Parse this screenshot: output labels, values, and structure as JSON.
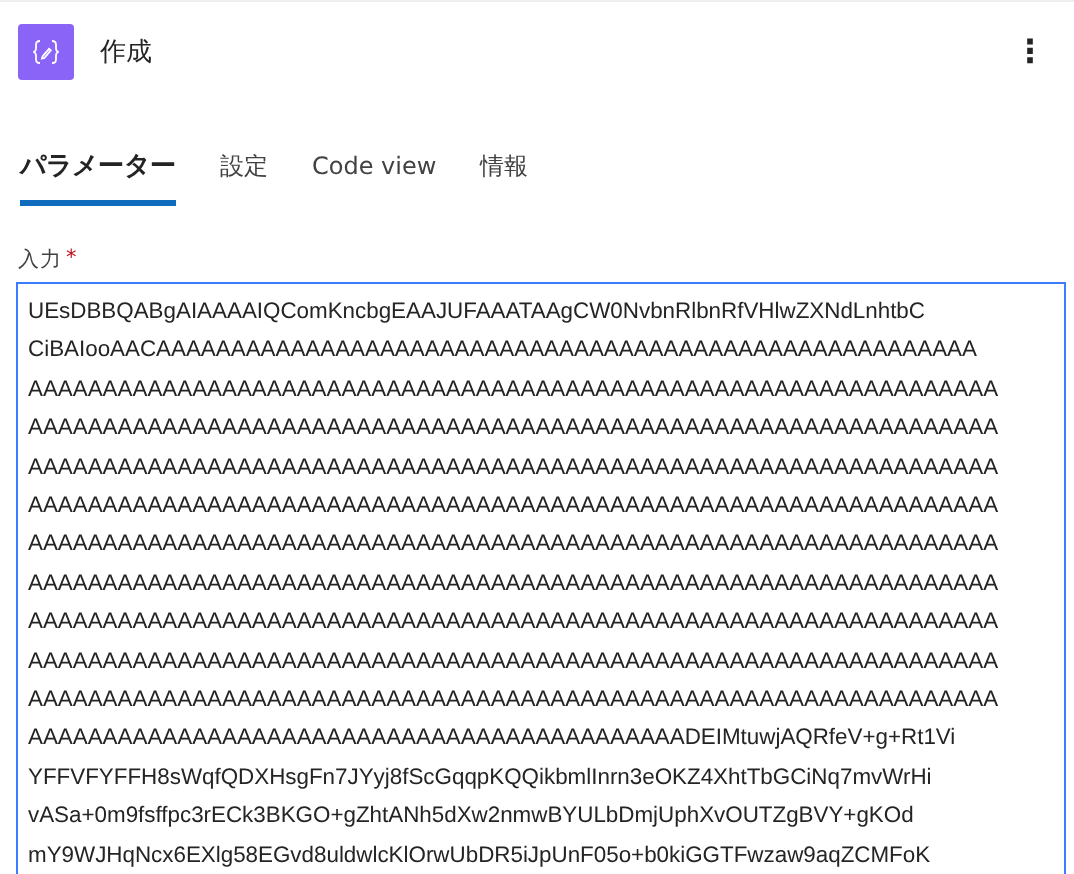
{
  "header": {
    "title": "作成",
    "menu_glyph": "⋮"
  },
  "tabs": [
    {
      "label": "パラメーター",
      "selected": true
    },
    {
      "label": "設定",
      "selected": false
    },
    {
      "label": "Code view",
      "selected": false
    },
    {
      "label": "情報",
      "selected": false
    }
  ],
  "input": {
    "label": "入力",
    "required_mark": "*",
    "value_lines": [
      "UEsDBBQABgAIAAAAIQComKncbgEAAJUFAAATAAgCW0NvbnRlbnRfVHlwZXNdLnhtbC",
      "CiBAIooAACAAAAAAAAAAAAAAAAAAAAAAAAAAAAAAAAAAAAAAAAAAAAAAAAAAAAAAA",
      "AAAAAAAAAAAAAAAAAAAAAAAAAAAAAAAAAAAAAAAAAAAAAAAAAAAAAAAAAAAAAAAAA",
      "AAAAAAAAAAAAAAAAAAAAAAAAAAAAAAAAAAAAAAAAAAAAAAAAAAAAAAAAAAAAAAAAA",
      "AAAAAAAAAAAAAAAAAAAAAAAAAAAAAAAAAAAAAAAAAAAAAAAAAAAAAAAAAAAAAAAAA",
      "AAAAAAAAAAAAAAAAAAAAAAAAAAAAAAAAAAAAAAAAAAAAAAAAAAAAAAAAAAAAAAAAA",
      "AAAAAAAAAAAAAAAAAAAAAAAAAAAAAAAAAAAAAAAAAAAAAAAAAAAAAAAAAAAAAAAAA",
      "AAAAAAAAAAAAAAAAAAAAAAAAAAAAAAAAAAAAAAAAAAAAAAAAAAAAAAAAAAAAAAAAA",
      "AAAAAAAAAAAAAAAAAAAAAAAAAAAAAAAAAAAAAAAAAAAAAAAAAAAAAAAAAAAAAAAAA",
      "AAAAAAAAAAAAAAAAAAAAAAAAAAAAAAAAAAAAAAAAAAAAAAAAAAAAAAAAAAAAAAAAA",
      "AAAAAAAAAAAAAAAAAAAAAAAAAAAAAAAAAAAAAAAAAAAAAAAAAAAAAAAAAAAAAAAAA",
      "AAAAAAAAAAAAAAAAAAAAAAAAAAAAAAAAAAAAAAAAAAAADEIMtuwjAQRfeV+g+Rt1Vi",
      "YFFVFYFFH8sWqfQDXHsgFn7JYyj8fScGqqpKQQikbmlInrn3eOKZ4XhtTbGCiNq7mvWrHi",
      "vASa+0m9fsffpc3rECk3BKGO+gZhtANh5dXw2nmwBYULbDmjUphXvOUTZgBVY+gKOd",
      "mY9WJHqNcx6EXlg58EGvd8uldwlcKlOrwUbDR5iJpUnF05o+b0kiGGTFwzaw9aqZCMFoK"
    ]
  }
}
